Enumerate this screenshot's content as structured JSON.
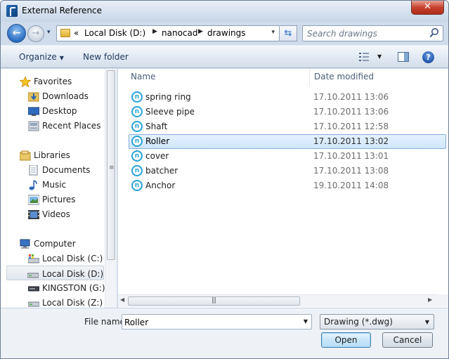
{
  "window": {
    "title": "External Reference",
    "close_glyph": "✕"
  },
  "navigation": {
    "back_glyph": "←",
    "forward_glyph": "→",
    "recent_glyph": "▾",
    "address": {
      "prefix": "«",
      "segments": [
        "Local Disk (D:)",
        "nanocad",
        "drawings"
      ],
      "dropdown_glyph": "▾"
    },
    "refresh_glyph": "⇆",
    "search": {
      "placeholder": "Search drawings"
    }
  },
  "toolbar": {
    "organize_label": "Organize",
    "organize_caret": "▼",
    "new_folder_label": "New folder",
    "view_caret": "▼",
    "help_glyph": "?"
  },
  "sidebar": {
    "groups": [
      {
        "label": "Favorites",
        "items": [
          "Downloads",
          "Desktop",
          "Recent Places"
        ]
      },
      {
        "label": "Libraries",
        "items": [
          "Documents",
          "Music",
          "Pictures",
          "Videos"
        ]
      },
      {
        "label": "Computer",
        "items": [
          "Local Disk (C:)",
          "Local Disk (D:)",
          "KINGSTON (G:)",
          "Local Disk (Z:)"
        ]
      }
    ],
    "selected": "Local Disk (D:)"
  },
  "file_list": {
    "columns": {
      "name": "Name",
      "date": "Date modified"
    },
    "files": [
      {
        "name": "spring ring",
        "date": "17.10.2011 13:06"
      },
      {
        "name": "Sleeve pipe",
        "date": "17.10.2011 13:06"
      },
      {
        "name": "Shaft",
        "date": "17.10.2011 12:58"
      },
      {
        "name": "Roller",
        "date": "17.10.2011 13:02"
      },
      {
        "name": "cover",
        "date": "17.10.2011 13:01"
      },
      {
        "name": "batcher",
        "date": "17.10.2011 13:08"
      },
      {
        "name": "Anchor",
        "date": "19.10.2011 14:08"
      }
    ],
    "selected": "Roller",
    "file_icon_glyph": "n"
  },
  "bottom": {
    "file_name_label": "File name:",
    "file_name_value": "Roller",
    "file_type_value": "Drawing (*.dwg)",
    "caret": "▼",
    "open_label": "Open",
    "cancel_label": "Cancel"
  },
  "colors": {
    "accent": "#27a3d6",
    "selection": "#cfe6fc",
    "close": "#c6422e"
  }
}
